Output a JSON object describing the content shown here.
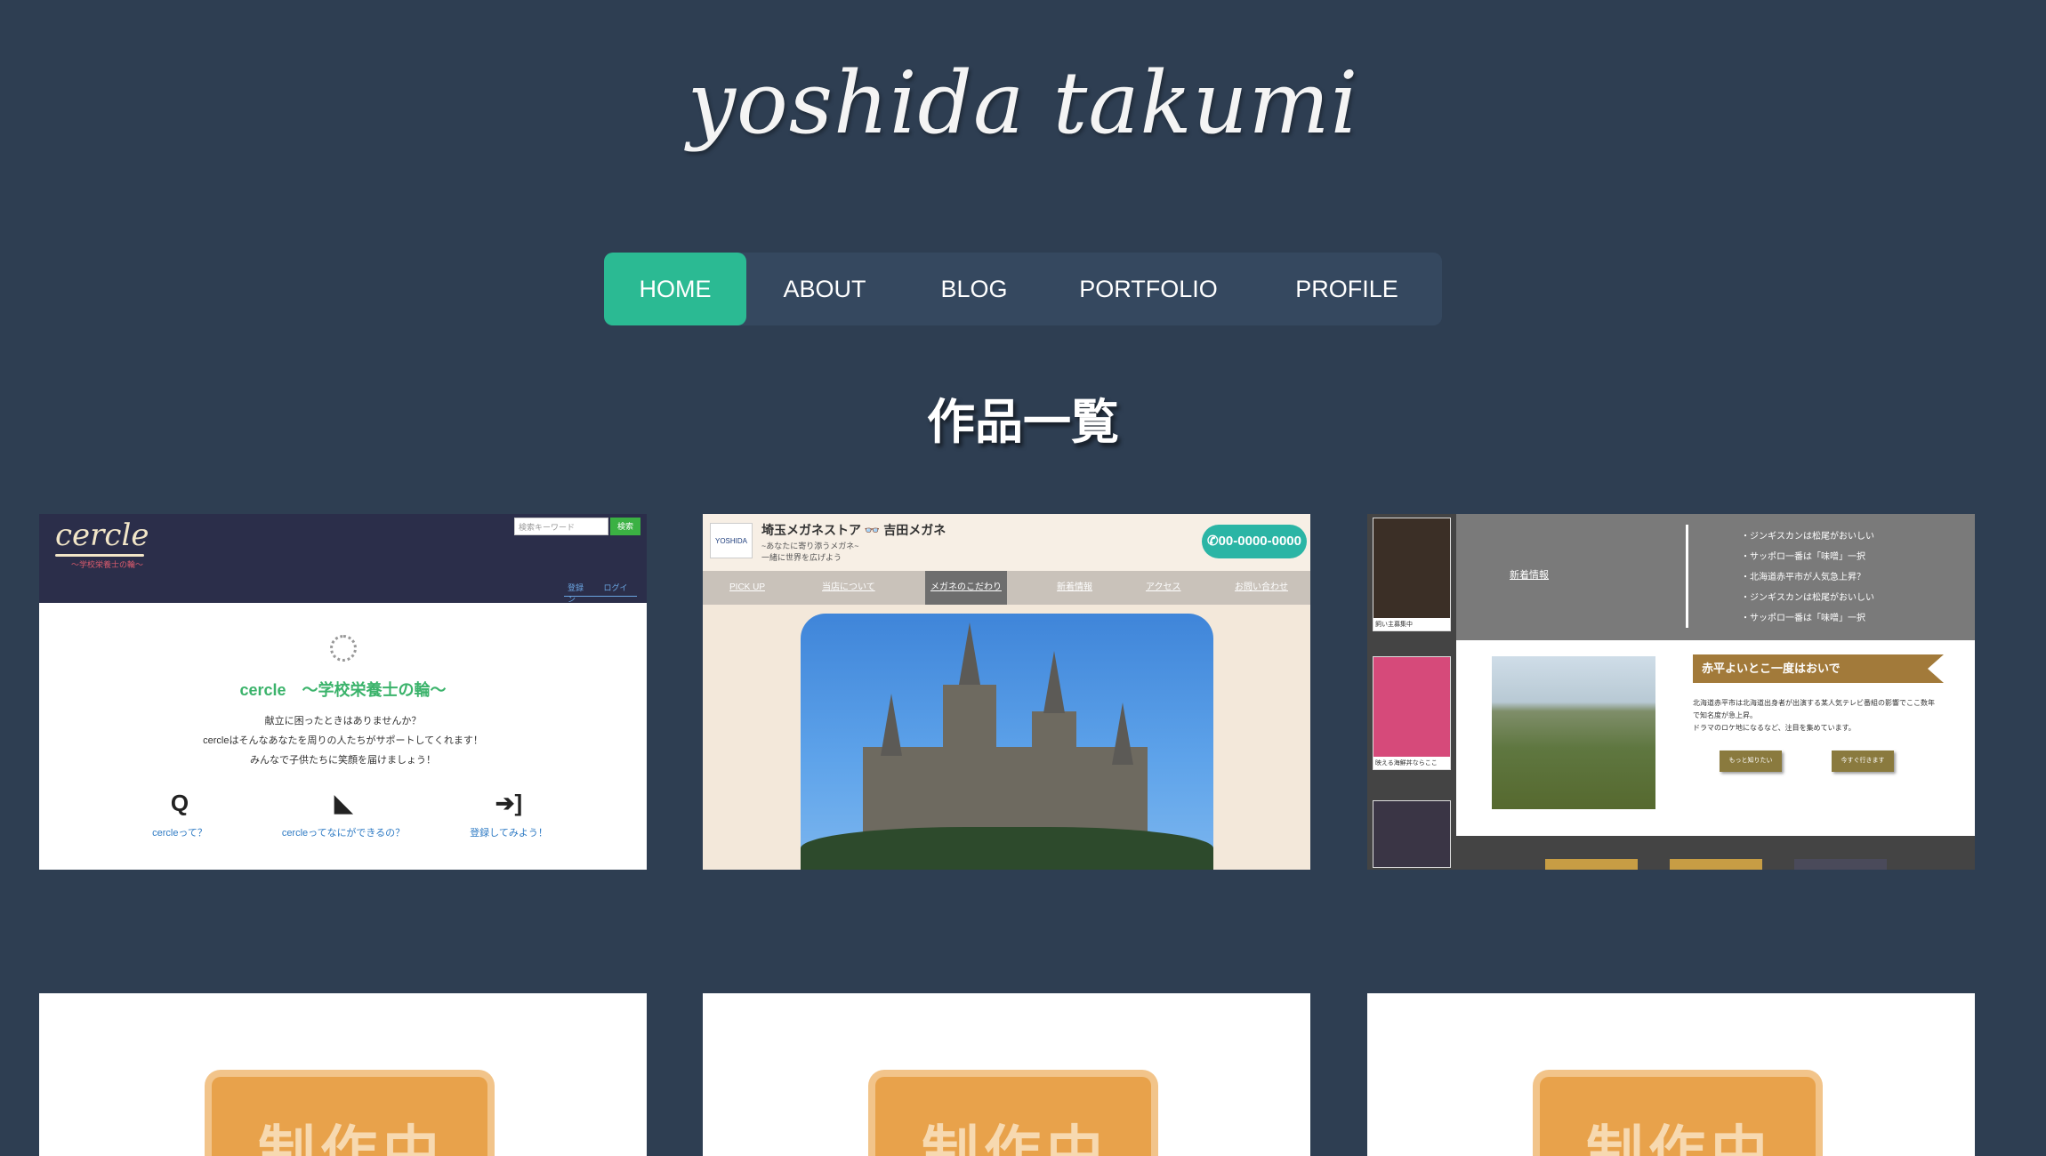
{
  "site": {
    "title": "yoshida takumi"
  },
  "nav": {
    "items": [
      {
        "label": "HOME"
      },
      {
        "label": "ABOUT"
      },
      {
        "label": "BLOG"
      },
      {
        "label": "PORTFOLIO"
      },
      {
        "label": "PROFILE"
      }
    ],
    "active_color": "#2bba93"
  },
  "section": {
    "title": "作品一覧"
  },
  "works": {
    "cercle": {
      "logo": "cercle",
      "logo_sub": "〜学校栄養士の輪〜",
      "search_placeholder": "検索キーワード",
      "search_button": "検索",
      "links": [
        "登録",
        "ログイン"
      ],
      "heading": "cercle　〜学校栄養士の輪〜",
      "body": [
        "献立に困ったときはありませんか？",
        "cercleはそんなあなたを周りの人たちがサポートしてくれます！",
        "みんなで子供たちに笑顔を届けましょう！"
      ],
      "features": [
        "cercleって？",
        "cercleってなにができるの？",
        "登録してみよう！"
      ]
    },
    "megane": {
      "logo": "YOSHIDA",
      "title": "埼玉メガネストア 👓 吉田メガネ",
      "sub": [
        "~あなたに寄り添うメガネ~",
        "一緒に世界を広げよう"
      ],
      "tel": "00-0000-0000",
      "nav": [
        "PICK UP",
        "当店について",
        "メガネのこだわり",
        "新着情報",
        "アクセス",
        "お問い合わせ"
      ]
    },
    "akabira": {
      "thumbs": [
        {
          "cap": "飼い主募集中"
        },
        {
          "cap": "映える海鮮丼ならここ"
        },
        {
          "cap": ""
        }
      ],
      "news_label": "新着情報",
      "news": [
        "・ジンギスカンは松尾がおいしい",
        "・サッポロ一番は「味噌」一択",
        "・北海道赤平市が人気急上昇？",
        "・ジンギスカンは松尾がおいしい",
        "・サッポロ一番は「味噌」一択"
      ],
      "banner": "赤平よいとこ一度はおいで",
      "text": [
        "北海道赤平市は北海道出身者が出演する某人気テレビ番組の影響でここ数年",
        "で知名度が急上昇。",
        "ドラマのロケ地になるなど、注目を集めています。"
      ],
      "buttons": [
        "もっと知りたい",
        "今すぐ行きます"
      ]
    },
    "wip": {
      "label": "制作中"
    }
  }
}
